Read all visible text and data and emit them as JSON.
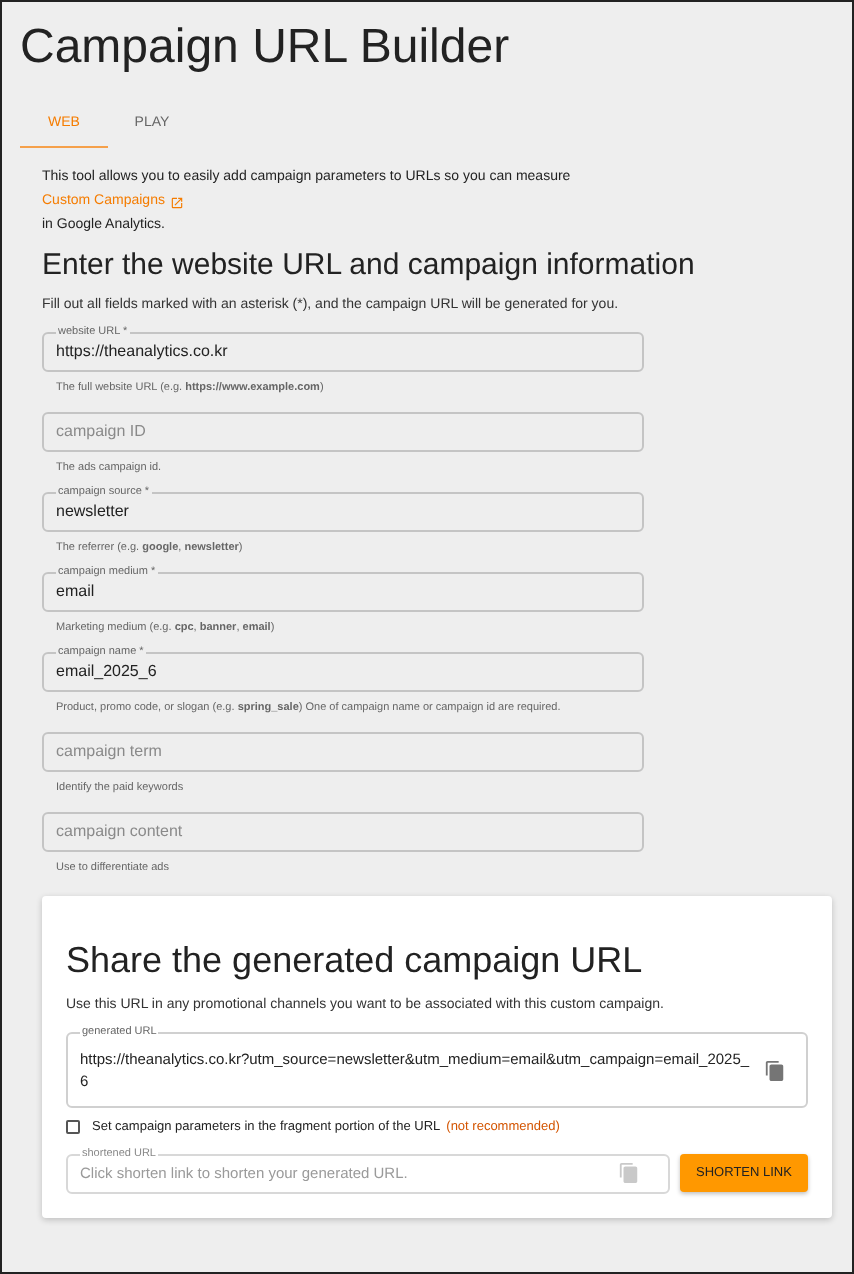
{
  "title": "Campaign URL Builder",
  "tabs": [
    {
      "label": "WEB",
      "selected": true
    },
    {
      "label": "PLAY",
      "selected": false
    }
  ],
  "intro": {
    "before": "This tool allows you to easily add campaign parameters to URLs so you can measure",
    "link": "Custom Campaigns",
    "after": "in Google Analytics."
  },
  "form": {
    "heading": "Enter the website URL and campaign information",
    "instructions": "Fill out all fields marked with an asterisk (*), and the campaign URL will be generated for you.",
    "fields": [
      {
        "label": "website URL *",
        "value": "https://theanalytics.co.kr",
        "helper": "The full website URL (e.g. **https://www.example.com**)"
      },
      {
        "placeholder": "campaign ID",
        "helper": "The ads campaign id."
      },
      {
        "label": "campaign source *",
        "value": "newsletter",
        "helper": "The referrer (e.g. **google**, **newsletter**)"
      },
      {
        "label": "campaign medium *",
        "value": "email",
        "helper": "Marketing medium (e.g. **cpc**, **banner**, **email**)"
      },
      {
        "label": "campaign name *",
        "value": "email_2025_6",
        "helper": "Product, promo code, or slogan (e.g. **spring_sale**) One of campaign name or campaign id are required."
      },
      {
        "placeholder": "campaign term",
        "helper": "Identify the paid keywords"
      },
      {
        "placeholder": "campaign content",
        "helper": "Use to differentiate ads"
      }
    ]
  },
  "share": {
    "heading": "Share the generated campaign URL",
    "description": "Use this URL in any promotional channels you want to be associated with this custom campaign.",
    "generated": {
      "label": "generated URL",
      "value": "https://theanalytics.co.kr?utm_source=newsletter&utm_medium=email&utm_campaign=email_2025_6"
    },
    "fragment_option": {
      "label": "Set campaign parameters in the fragment portion of the URL",
      "note": "(not recommended)",
      "checked": false
    },
    "shortened": {
      "label": "shortened URL",
      "placeholder": "Click shorten link to shorten your generated URL."
    },
    "button": "SHORTEN LINK"
  }
}
